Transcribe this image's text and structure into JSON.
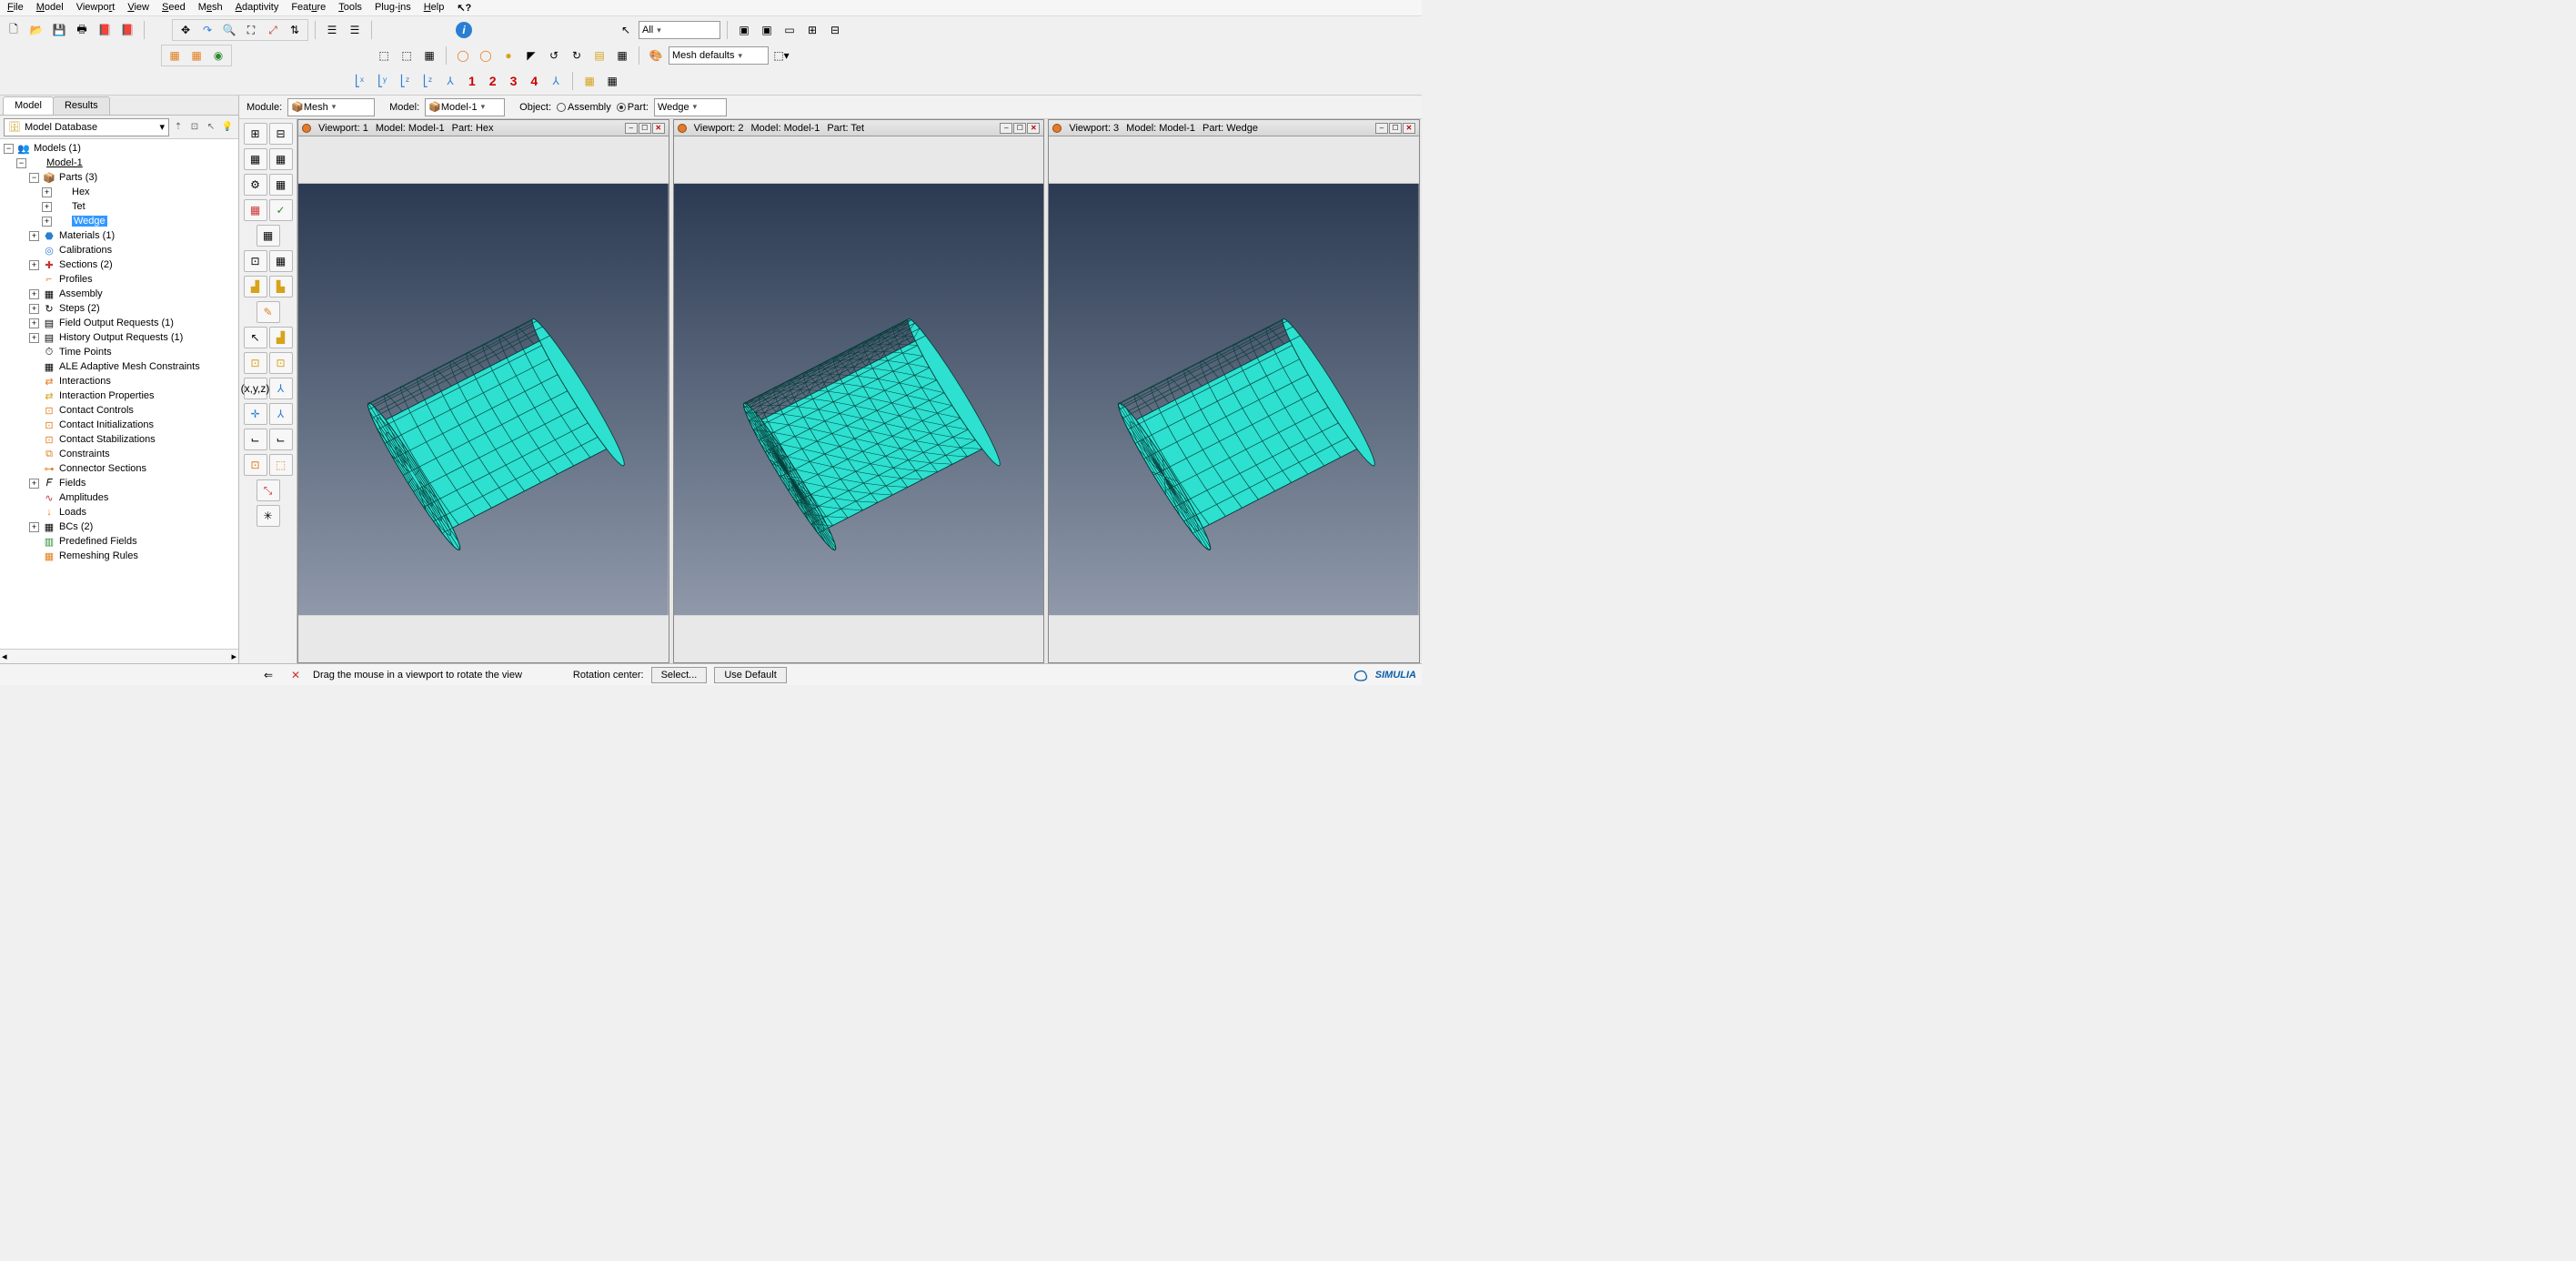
{
  "menu": {
    "items": [
      "File",
      "Model",
      "Viewport",
      "View",
      "Seed",
      "Mesh",
      "Adaptivity",
      "Feature",
      "Tools",
      "Plug-ins",
      "Help"
    ]
  },
  "context": {
    "module_label": "Module:",
    "module_value": "Mesh",
    "model_label": "Model:",
    "model_value": "Model-1",
    "object_label": "Object:",
    "assembly_label": "Assembly",
    "part_label": "Part:",
    "part_value": "Wedge"
  },
  "selector_all": "All",
  "mesh_defaults": "Mesh defaults",
  "datum_numbers": [
    "1",
    "2",
    "3",
    "4"
  ],
  "tabs": {
    "model": "Model",
    "results": "Results"
  },
  "tree_db": "Model Database",
  "tree": [
    {
      "d": 0,
      "exp": "-",
      "icon": "👥",
      "label": "Models (1)"
    },
    {
      "d": 1,
      "exp": "-",
      "icon": "",
      "label": "Model-1",
      "ul": true
    },
    {
      "d": 2,
      "exp": "-",
      "icon": "📦",
      "label": "Parts (3)",
      "iclr": "ic-yellow"
    },
    {
      "d": 3,
      "exp": "+",
      "icon": "",
      "label": "Hex"
    },
    {
      "d": 3,
      "exp": "+",
      "icon": "",
      "label": "Tet"
    },
    {
      "d": 3,
      "exp": "+",
      "icon": "",
      "label": "Wedge",
      "sel": true
    },
    {
      "d": 2,
      "exp": "+",
      "icon": "⬣",
      "label": "Materials (1)",
      "iclr": "ic-blue"
    },
    {
      "d": 2,
      "exp": "",
      "icon": "◎",
      "label": "Calibrations",
      "iclr": "ic-blue"
    },
    {
      "d": 2,
      "exp": "+",
      "icon": "✚",
      "label": "Sections (2)",
      "iclr": "ic-red"
    },
    {
      "d": 2,
      "exp": "",
      "icon": "⌐",
      "label": "Profiles",
      "iclr": "ic-orange"
    },
    {
      "d": 2,
      "exp": "+",
      "icon": "▦",
      "label": "Assembly"
    },
    {
      "d": 2,
      "exp": "+",
      "icon": "↻",
      "label": "Steps (2)"
    },
    {
      "d": 2,
      "exp": "+",
      "icon": "▤",
      "label": "Field Output Requests (1)"
    },
    {
      "d": 2,
      "exp": "+",
      "icon": "▤",
      "label": "History Output Requests (1)"
    },
    {
      "d": 2,
      "exp": "",
      "icon": "⏱",
      "label": "Time Points"
    },
    {
      "d": 2,
      "exp": "",
      "icon": "▦",
      "label": "ALE Adaptive Mesh Constraints"
    },
    {
      "d": 2,
      "exp": "",
      "icon": "⇄",
      "label": "Interactions",
      "iclr": "ic-orange"
    },
    {
      "d": 2,
      "exp": "",
      "icon": "⇄",
      "label": "Interaction Properties",
      "iclr": "ic-yellow"
    },
    {
      "d": 2,
      "exp": "",
      "icon": "⊡",
      "label": "Contact Controls",
      "iclr": "ic-orange"
    },
    {
      "d": 2,
      "exp": "",
      "icon": "⊡",
      "label": "Contact Initializations",
      "iclr": "ic-orange"
    },
    {
      "d": 2,
      "exp": "",
      "icon": "⊡",
      "label": "Contact Stabilizations",
      "iclr": "ic-orange"
    },
    {
      "d": 2,
      "exp": "",
      "icon": "⧉",
      "label": "Constraints",
      "iclr": "ic-orange"
    },
    {
      "d": 2,
      "exp": "",
      "icon": "⊶",
      "label": "Connector Sections",
      "iclr": "ic-orange"
    },
    {
      "d": 2,
      "exp": "+",
      "icon": "𝐹",
      "label": "Fields"
    },
    {
      "d": 2,
      "exp": "",
      "icon": "∿",
      "label": "Amplitudes",
      "iclr": "ic-red"
    },
    {
      "d": 2,
      "exp": "",
      "icon": "↓",
      "label": "Loads",
      "iclr": "ic-orange"
    },
    {
      "d": 2,
      "exp": "+",
      "icon": "▦",
      "label": "BCs (2)"
    },
    {
      "d": 2,
      "exp": "",
      "icon": "▥",
      "label": "Predefined Fields",
      "iclr": "ic-green"
    },
    {
      "d": 2,
      "exp": "",
      "icon": "▦",
      "label": "Remeshing Rules",
      "iclr": "ic-orange"
    }
  ],
  "viewports": [
    {
      "n": "1",
      "model": "Model-1",
      "part": "Hex"
    },
    {
      "n": "2",
      "model": "Model-1",
      "part": "Tet"
    },
    {
      "n": "3",
      "model": "Model-1",
      "part": "Wedge"
    }
  ],
  "vp_labels": {
    "viewport": "Viewport:",
    "model": "Model:",
    "part": "Part:"
  },
  "status": {
    "hint": "Drag the mouse in a viewport to rotate the view",
    "rot_label": "Rotation center:",
    "select": "Select...",
    "default": "Use Default",
    "brand": "SIMULIA"
  }
}
